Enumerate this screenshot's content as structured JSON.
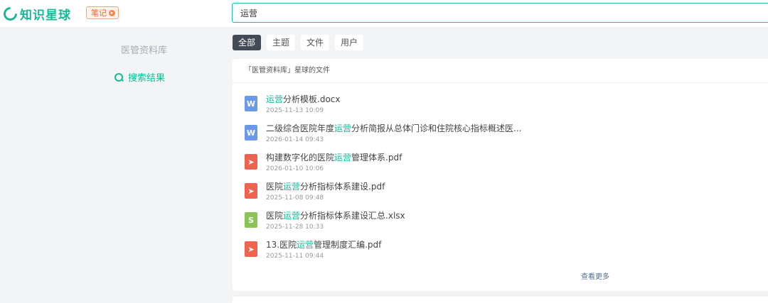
{
  "app": {
    "logo_text": "知识星球",
    "note_badge": "笔记",
    "note_arrow": "▸"
  },
  "search": {
    "value": "运营"
  },
  "sidebar": {
    "title": "医管资料库",
    "items": [
      {
        "label": "搜索结果",
        "icon": "search-icon",
        "active": true
      }
    ]
  },
  "tabs": [
    {
      "label": "全部",
      "active": true
    },
    {
      "label": "主题",
      "active": false
    },
    {
      "label": "文件",
      "active": false
    },
    {
      "label": "用户",
      "active": false
    }
  ],
  "results": {
    "header": "「医管资料库」星球的文件",
    "files": [
      {
        "type": "word",
        "icon_glyph": "W",
        "pre": "",
        "hl": "运营",
        "post": "分析模板.docx",
        "time": "2025-11-13 10:09"
      },
      {
        "type": "word",
        "icon_glyph": "W",
        "pre": "二级综合医院年度",
        "hl": "运营",
        "post": "分析简报从总体门诊和住院核心指标概述医...",
        "time": "2026-01-14 09:43"
      },
      {
        "type": "pdf",
        "icon_glyph": "➤",
        "pre": "构建数字化的医院",
        "hl": "运营",
        "post": "管理体系.pdf",
        "time": "2026-01-10 10:06"
      },
      {
        "type": "pdf",
        "icon_glyph": "➤",
        "pre": "医院",
        "hl": "运营",
        "post": "分析指标体系建设.pdf",
        "time": "2025-11-08 09:48"
      },
      {
        "type": "xls",
        "icon_glyph": "S",
        "pre": "医院",
        "hl": "运营",
        "post": "分析指标体系建设汇总.xlsx",
        "time": "2025-11-28 10:33"
      },
      {
        "type": "pdf",
        "icon_glyph": "➤",
        "pre": "13.医院",
        "hl": "运营",
        "post": "管理制度汇编.pdf",
        "time": "2025-11-11 09:44"
      }
    ],
    "see_more": "查看更多"
  },
  "colors": {
    "accent": "#16b998",
    "word": "#6b98e8",
    "pdf": "#ef6450",
    "xls": "#8bc557",
    "active_tab": "#444a56"
  }
}
